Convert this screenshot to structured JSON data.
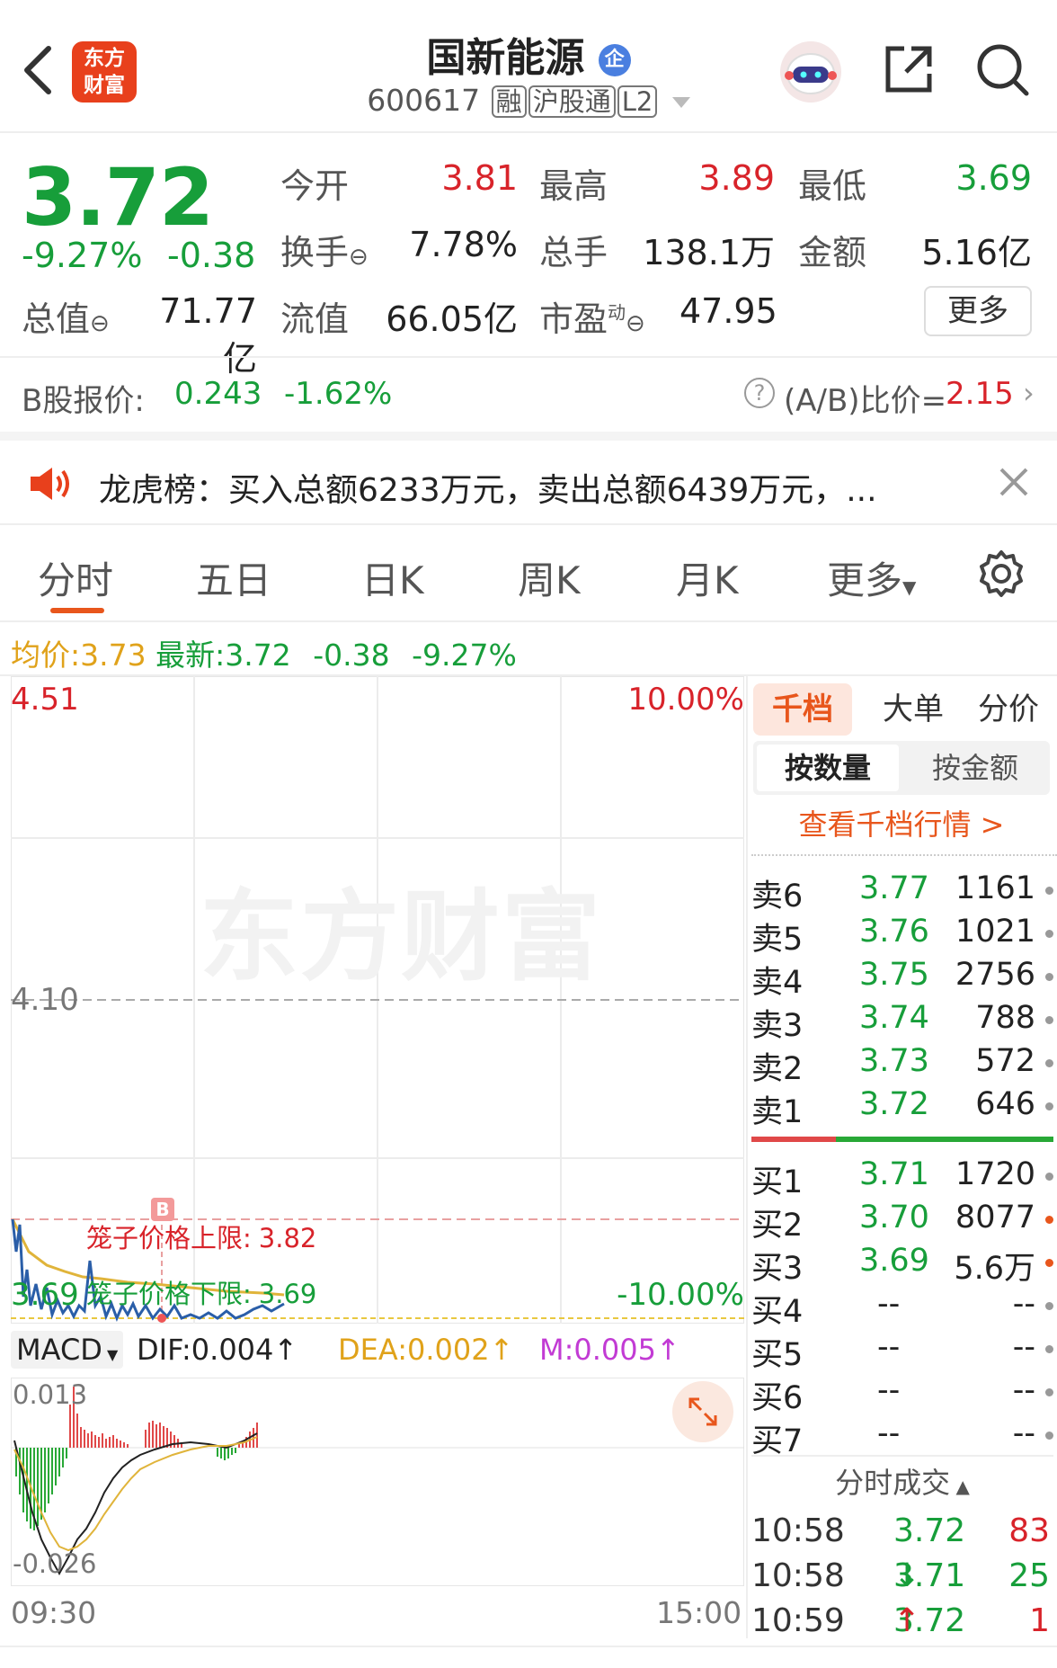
{
  "header": {
    "title": "国新能源",
    "badge": "企",
    "code": "600617",
    "tags": [
      "融",
      "沪股通",
      "L2"
    ],
    "logo_line1": "东方",
    "logo_line2": "财富"
  },
  "quote": {
    "price": "3.72",
    "change_pct": "-9.27%",
    "change": "-0.38",
    "rows": [
      [
        {
          "label": "今开",
          "value": "3.81"
        },
        {
          "label": "最高",
          "value": "3.89"
        },
        {
          "label": "最低",
          "value": "3.69"
        }
      ],
      [
        {
          "label": "换手",
          "value": "7.78%"
        },
        {
          "label": "总手",
          "value": "138.1万"
        },
        {
          "label": "金额",
          "value": "5.16亿"
        }
      ],
      [
        {
          "label": "流值",
          "value": "66.05亿"
        },
        {
          "label": "市盈",
          "value": "47.95"
        }
      ]
    ],
    "total_value_label": "总值",
    "total_value": "71.77亿",
    "pe_sup": "动",
    "more_button": "更多"
  },
  "b_share": {
    "label": "B股报价:",
    "price": "0.243",
    "change_pct": "-1.62%",
    "ratio_label": "(A/B)比价=",
    "ratio_value": "2.15"
  },
  "notice": {
    "text": "龙虎榜：买入总额6233万元，卖出总额6439万元，..."
  },
  "tabs": [
    "分时",
    "五日",
    "日K",
    "周K",
    "月K",
    "更多"
  ],
  "active_tab": "分时",
  "intraday": {
    "avg_label": "均价:",
    "avg_value": "3.73",
    "latest_label": "最新:",
    "latest_value": "3.72",
    "latest_change": "-0.38",
    "latest_pct": "-9.27%",
    "y_top": "4.51",
    "y_mid": "4.10",
    "y_bottom": "3.69",
    "pct_top": "10.00%",
    "pct_bottom": "-10.00%",
    "upper_limit_label": "笼子价格上限:",
    "upper_limit": "3.82",
    "lower_limit_label": "笼子价格下限:",
    "lower_limit": "3.69",
    "marker": "B",
    "watermark": "东方财富",
    "time_start": "09:30",
    "time_end": "15:00",
    "colors": {
      "price_line": "#2a5ea8",
      "avg_line": "#e0b43a"
    }
  },
  "macd": {
    "label": "MACD",
    "dif": "DIF:0.004↑",
    "dea": "DEA:0.002↑",
    "m": "M:0.005↑",
    "y_top": "0.013",
    "y_bottom": "-0.026"
  },
  "orderbook": {
    "tabs": [
      "千档",
      "大单",
      "分价"
    ],
    "sub_tabs": [
      "按数量",
      "按金额"
    ],
    "link": "查看千档行情 >",
    "sells": [
      {
        "label": "卖6",
        "price": "3.77",
        "vol": "1161"
      },
      {
        "label": "卖5",
        "price": "3.76",
        "vol": "1021"
      },
      {
        "label": "卖4",
        "price": "3.75",
        "vol": "2756"
      },
      {
        "label": "卖3",
        "price": "3.74",
        "vol": "788"
      },
      {
        "label": "卖2",
        "price": "3.73",
        "vol": "572"
      },
      {
        "label": "卖1",
        "price": "3.72",
        "vol": "646"
      }
    ],
    "buys": [
      {
        "label": "买1",
        "price": "3.71",
        "vol": "1720"
      },
      {
        "label": "买2",
        "price": "3.70",
        "vol": "8077"
      },
      {
        "label": "买3",
        "price": "3.69",
        "vol": "5.6万"
      },
      {
        "label": "买4",
        "price": "--",
        "vol": "--"
      },
      {
        "label": "买5",
        "price": "--",
        "vol": "--"
      },
      {
        "label": "买6",
        "price": "--",
        "vol": "--"
      },
      {
        "label": "买7",
        "price": "--",
        "vol": "--"
      }
    ],
    "ticks_title": "分时成交",
    "ticks": [
      {
        "time": "10:58",
        "price": "3.72",
        "arrow": "",
        "vol": "83"
      },
      {
        "time": "10:58",
        "price": "3.71",
        "arrow": "↓",
        "vol": "25"
      },
      {
        "time": "10:59",
        "price": "3.72",
        "arrow": "↑",
        "vol": "1"
      }
    ]
  }
}
